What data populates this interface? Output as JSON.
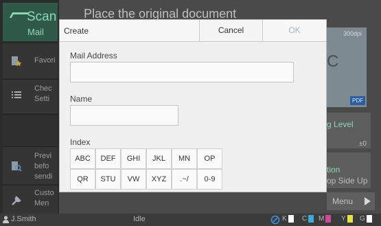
{
  "app": {
    "mode_name": "Scan",
    "mode_sub": "Mail",
    "background_title": "Place the original document"
  },
  "sidebar": {
    "items": [
      {
        "label": "Favori",
        "icon": "favorites-icon"
      },
      {
        "label": "Chec\nSetti",
        "icon": "list-icon"
      },
      {
        "label": "Previ\nbefo\nsendi",
        "icon": "preview-icon"
      },
      {
        "label": "Custo\nMen",
        "icon": "wrench-icon"
      }
    ]
  },
  "background_panel": {
    "dpi": "300dpi",
    "format": "PDF",
    "letter": "C",
    "level_label": "g Level",
    "level_value": "±0",
    "orientation_1": "tion",
    "orientation_2": "op Side Up",
    "menu_label": "Menu"
  },
  "dialog": {
    "title": "Create",
    "cancel_label": "Cancel",
    "ok_label": "OK",
    "mail_label": "Mail Address",
    "mail_value": "",
    "name_label": "Name",
    "name_value": "",
    "index_label": "Index",
    "index_row1": [
      "ABC",
      "DEF",
      "GHI",
      "JKL",
      "MN",
      "OP"
    ],
    "index_row2": [
      "QR",
      "STU",
      "VW",
      "XYZ",
      ".~/",
      "0-9"
    ]
  },
  "status": {
    "user": "J.Smith",
    "state": "Idle",
    "toner": [
      {
        "label": "K",
        "color": "#ffffff"
      },
      {
        "label": "C",
        "color": "#3fa9d9"
      },
      {
        "label": "M",
        "color": "#d04a9a"
      },
      {
        "label": "Y",
        "color": "#e8e04a"
      },
      {
        "label": "G",
        "color": "#ffffff"
      }
    ]
  },
  "colors": {
    "mode_accent": "#8fd6b4",
    "ok_disabled": "#9fb6c8"
  }
}
